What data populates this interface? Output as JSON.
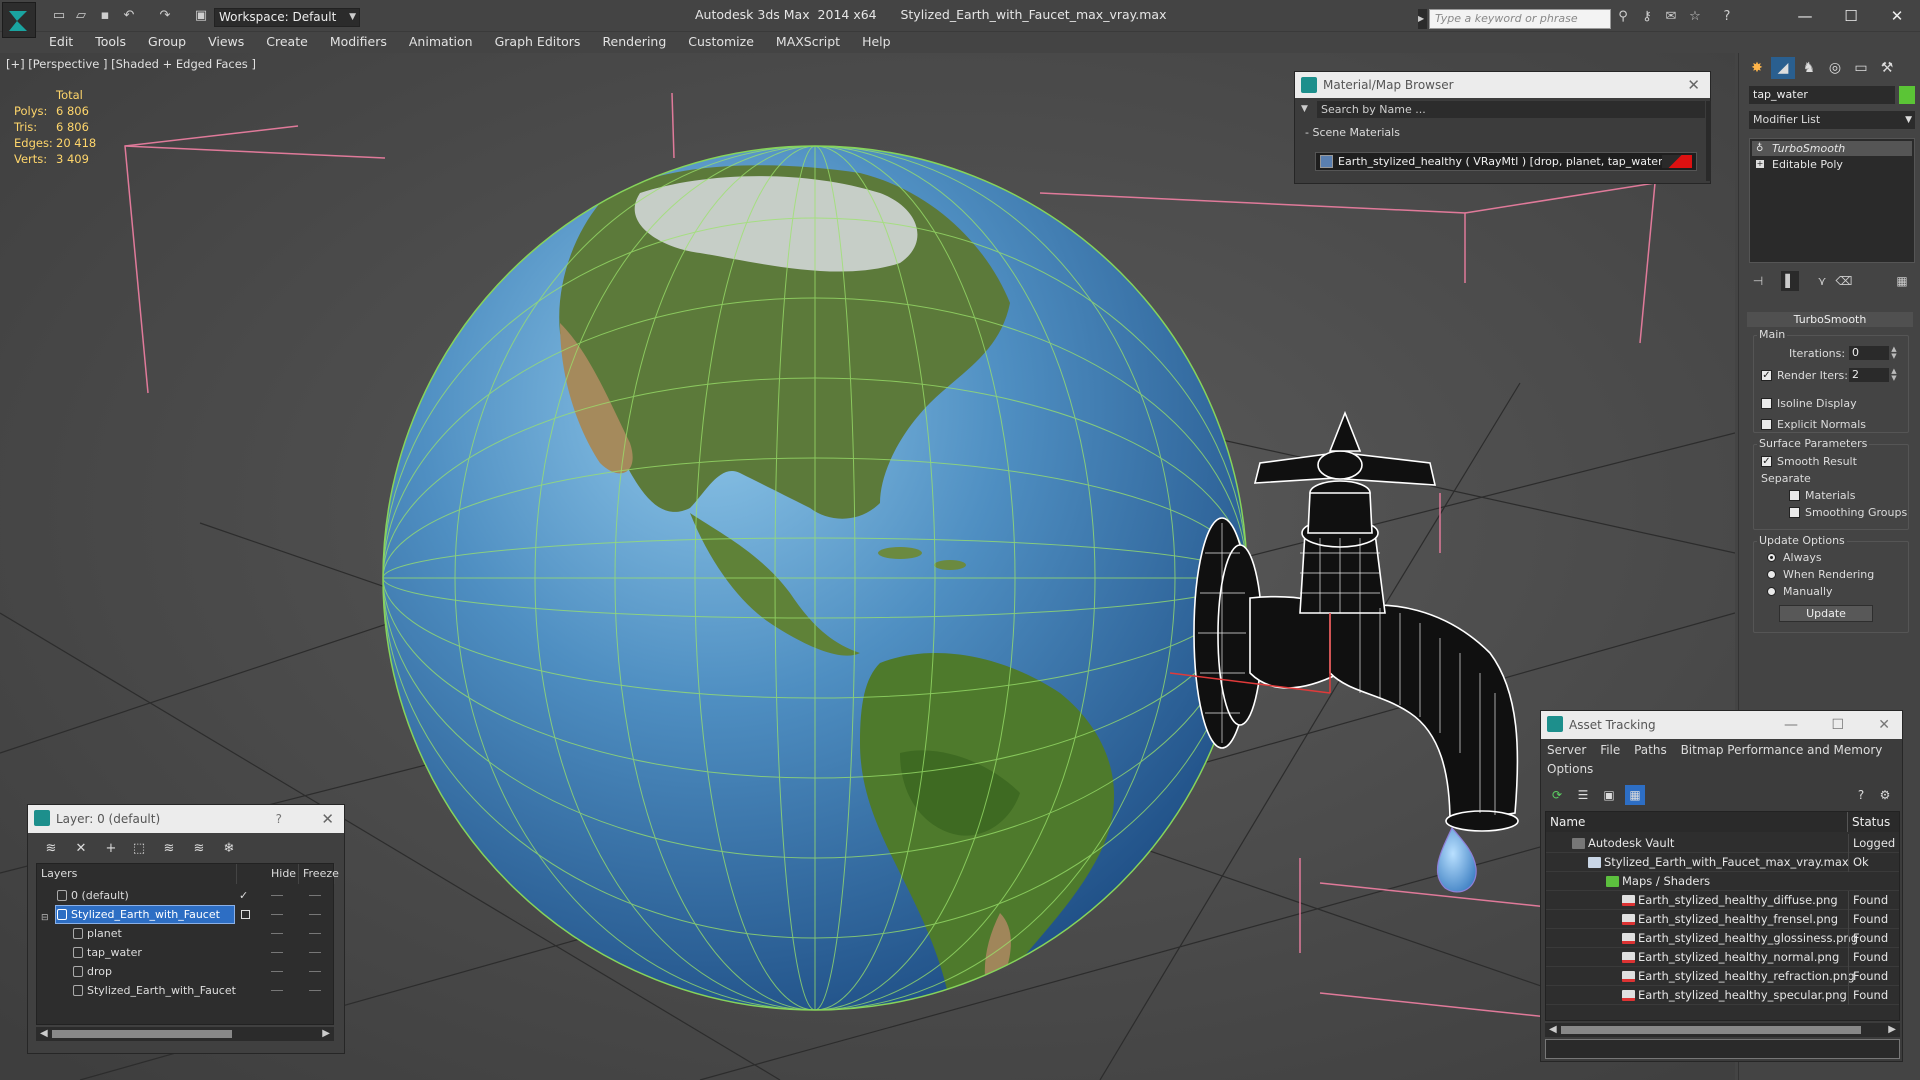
{
  "titlebar": {
    "app_name": "Autodesk 3ds Max  2014 x64",
    "file_name": "Stylized_Earth_with_Faucet_max_vray.max",
    "workspace": "Workspace: Default",
    "search_placeholder": "Type a keyword or phrase"
  },
  "menu": [
    "Edit",
    "Tools",
    "Group",
    "Views",
    "Create",
    "Modifiers",
    "Animation",
    "Graph Editors",
    "Rendering",
    "Customize",
    "MAXScript",
    "Help"
  ],
  "viewport": {
    "label": "[+] [Perspective ] [Shaded + Edged Faces ]",
    "stats": {
      "total_label": "Total",
      "rows": [
        {
          "label": "Polys:",
          "value": "6 806"
        },
        {
          "label": "Tris:",
          "value": "6 806"
        },
        {
          "label": "Edges:",
          "value": "20 418"
        },
        {
          "label": "Verts:",
          "value": "3 409"
        }
      ]
    }
  },
  "material_browser": {
    "title": "Material/Map Browser",
    "search_placeholder": "Search by Name ...",
    "section": "Scene Materials",
    "item": "Earth_stylized_healthy  ( VRayMtl ) [drop, planet, tap_water]"
  },
  "command_panel": {
    "object_name": "tap_water",
    "object_color": "#5bc536",
    "modifier_list": "Modifier List",
    "stack": [
      "TurboSmooth",
      "Editable Poly"
    ],
    "rollout_title": "TurboSmooth",
    "main_group": "Main",
    "iterations_label": "Iterations:",
    "iterations_value": "0",
    "render_iters_label": "Render Iters:",
    "render_iters_value": "2",
    "isoline": "Isoline Display",
    "explicit_normals": "Explicit Normals",
    "surface_group": "Surface Parameters",
    "smooth_result": "Smooth Result",
    "separate": "Separate",
    "materials": "Materials",
    "smoothing_groups": "Smoothing Groups",
    "update_group": "Update Options",
    "always": "Always",
    "when_rendering": "When Rendering",
    "manually": "Manually",
    "update_button": "Update"
  },
  "layer_window": {
    "title": "Layer: 0 (default)",
    "help": "?",
    "col_layers": "Layers",
    "col_hide": "Hide",
    "col_freeze": "Freeze",
    "rows": [
      {
        "name": "0 (default)",
        "indent": 1
      },
      {
        "name": "Stylized_Earth_with_Faucet",
        "indent": 1
      },
      {
        "name": "planet",
        "indent": 2
      },
      {
        "name": "tap_water",
        "indent": 2
      },
      {
        "name": "drop",
        "indent": 2
      },
      {
        "name": "Stylized_Earth_with_Faucet",
        "indent": 2
      }
    ]
  },
  "asset_window": {
    "title": "Asset Tracking",
    "menu": [
      "Server",
      "File",
      "Paths",
      "Bitmap Performance and Memory",
      "Options"
    ],
    "col_name": "Name",
    "col_status": "Status",
    "rows": [
      {
        "name": "Autodesk Vault",
        "status": "Logged O",
        "indent": 0
      },
      {
        "name": "Stylized_Earth_with_Faucet_max_vray.max",
        "status": "Ok",
        "indent": 1
      },
      {
        "name": "Maps / Shaders",
        "status": "",
        "indent": 2
      },
      {
        "name": "Earth_stylized_healthy_diffuse.png",
        "status": "Found",
        "indent": 3
      },
      {
        "name": "Earth_stylized_healthy_frensel.png",
        "status": "Found",
        "indent": 3
      },
      {
        "name": "Earth_stylized_healthy_glossiness.png",
        "status": "Found",
        "indent": 3
      },
      {
        "name": "Earth_stylized_healthy_normal.png",
        "status": "Found",
        "indent": 3
      },
      {
        "name": "Earth_stylized_healthy_refraction.png",
        "status": "Found",
        "indent": 3
      },
      {
        "name": "Earth_stylized_healthy_specular.png",
        "status": "Found",
        "indent": 3
      }
    ]
  }
}
